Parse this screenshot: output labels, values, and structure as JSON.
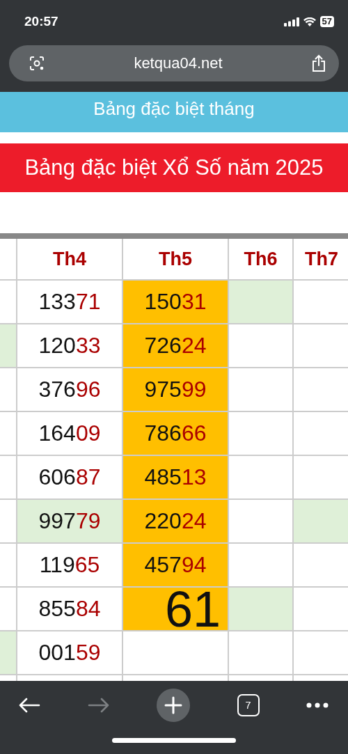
{
  "status_bar": {
    "time": "20:57",
    "battery": "57"
  },
  "address_bar": {
    "url": "ketqua04.net"
  },
  "month_banner": "Bảng đặc biệt tháng",
  "year_banner": "Bảng đặc biệt Xổ Số năm 2025",
  "table": {
    "columns": [
      "Th4",
      "Th5",
      "Th6",
      "Th7"
    ],
    "rows": [
      {
        "edge": {
          "color": "#ffffff"
        },
        "cells": [
          {
            "kind": "number",
            "color": "#ffffff",
            "head": "133",
            "tail": "71"
          },
          {
            "kind": "number",
            "color": "#ffbf00",
            "head": "150",
            "tail": "31"
          },
          {
            "kind": "empty",
            "color": "#dff0d8"
          },
          {
            "kind": "empty",
            "color": "#ffffff"
          }
        ]
      },
      {
        "edge": {
          "color": "#dff0d8"
        },
        "cells": [
          {
            "kind": "number",
            "color": "#ffffff",
            "head": "120",
            "tail": "33"
          },
          {
            "kind": "number",
            "color": "#ffbf00",
            "head": "726",
            "tail": "24"
          },
          {
            "kind": "empty",
            "color": "#ffffff"
          },
          {
            "kind": "empty",
            "color": "#ffffff"
          }
        ]
      },
      {
        "edge": {
          "color": "#ffffff"
        },
        "cells": [
          {
            "kind": "number",
            "color": "#ffffff",
            "head": "376",
            "tail": "96"
          },
          {
            "kind": "number",
            "color": "#ffbf00",
            "head": "975",
            "tail": "99"
          },
          {
            "kind": "empty",
            "color": "#ffffff"
          },
          {
            "kind": "empty",
            "color": "#ffffff"
          }
        ]
      },
      {
        "edge": {
          "color": "#ffffff"
        },
        "cells": [
          {
            "kind": "number",
            "color": "#ffffff",
            "head": "164",
            "tail": "09"
          },
          {
            "kind": "number",
            "color": "#ffbf00",
            "head": "786",
            "tail": "66"
          },
          {
            "kind": "empty",
            "color": "#ffffff"
          },
          {
            "kind": "empty",
            "color": "#ffffff"
          }
        ]
      },
      {
        "edge": {
          "color": "#ffffff"
        },
        "cells": [
          {
            "kind": "number",
            "color": "#ffffff",
            "head": "606",
            "tail": "87"
          },
          {
            "kind": "number",
            "color": "#ffbf00",
            "head": "485",
            "tail": "13"
          },
          {
            "kind": "empty",
            "color": "#ffffff"
          },
          {
            "kind": "empty",
            "color": "#ffffff"
          }
        ]
      },
      {
        "edge": {
          "color": "#ffffff"
        },
        "cells": [
          {
            "kind": "number",
            "color": "#dff0d8",
            "head": "997",
            "tail": "79"
          },
          {
            "kind": "number",
            "color": "#ffbf00",
            "head": "220",
            "tail": "24"
          },
          {
            "kind": "empty",
            "color": "#ffffff"
          },
          {
            "kind": "empty",
            "color": "#dff0d8"
          }
        ]
      },
      {
        "edge": {
          "color": "#ffffff"
        },
        "cells": [
          {
            "kind": "number",
            "color": "#ffffff",
            "head": "119",
            "tail": "65"
          },
          {
            "kind": "number",
            "color": "#ffbf00",
            "head": "457",
            "tail": "94"
          },
          {
            "kind": "empty",
            "color": "#ffffff"
          },
          {
            "kind": "empty",
            "color": "#ffffff"
          }
        ]
      },
      {
        "edge": {
          "color": "#ffffff"
        },
        "cells": [
          {
            "kind": "number",
            "color": "#ffffff",
            "head": "855",
            "tail": "84"
          },
          {
            "kind": "large",
            "color": "#ffbf00",
            "value": "61"
          },
          {
            "kind": "empty",
            "color": "#dff0d8"
          },
          {
            "kind": "empty",
            "color": "#ffffff"
          }
        ]
      },
      {
        "edge": {
          "color": "#dff0d8"
        },
        "cells": [
          {
            "kind": "number",
            "color": "#ffffff",
            "head": "001",
            "tail": "59"
          },
          {
            "kind": "empty",
            "color": "#ffffff"
          },
          {
            "kind": "empty",
            "color": "#ffffff"
          },
          {
            "kind": "empty",
            "color": "#ffffff"
          }
        ]
      }
    ]
  },
  "toolbar": {
    "tab_count": "7",
    "forward_disabled": true
  }
}
